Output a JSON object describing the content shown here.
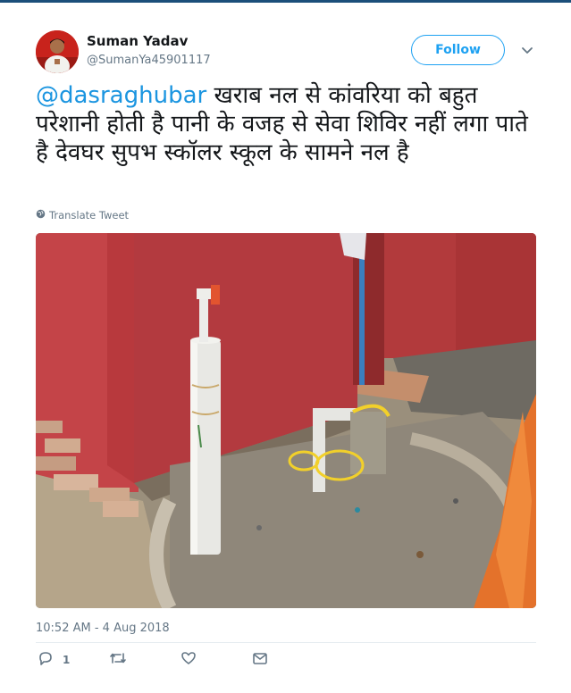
{
  "author": {
    "name": "Suman Yadav",
    "handle": "@SumanYa45901117"
  },
  "follow_label": "Follow",
  "tweet": {
    "mention": "@dasraghubar",
    "text": " खराब नल से कांवरिया को बहुत परेशानी  होती है पानी के वजह से सेवा शिविर नहीं लगा पाते है देवघर सुपभ स्कॉलर स्कूल के सामने नल है"
  },
  "translate_label": "Translate Tweet",
  "timestamp": "10:52 AM - 4 Aug 2018",
  "actions": {
    "reply_count": "1"
  },
  "colors": {
    "accent": "#1da1f2",
    "mention": "#1b95e0",
    "muted": "#657786",
    "topbar": "#1c4f7a"
  },
  "icons": [
    "globe-icon",
    "reply-icon",
    "retweet-icon",
    "like-icon",
    "message-icon",
    "chevron-down-icon"
  ]
}
